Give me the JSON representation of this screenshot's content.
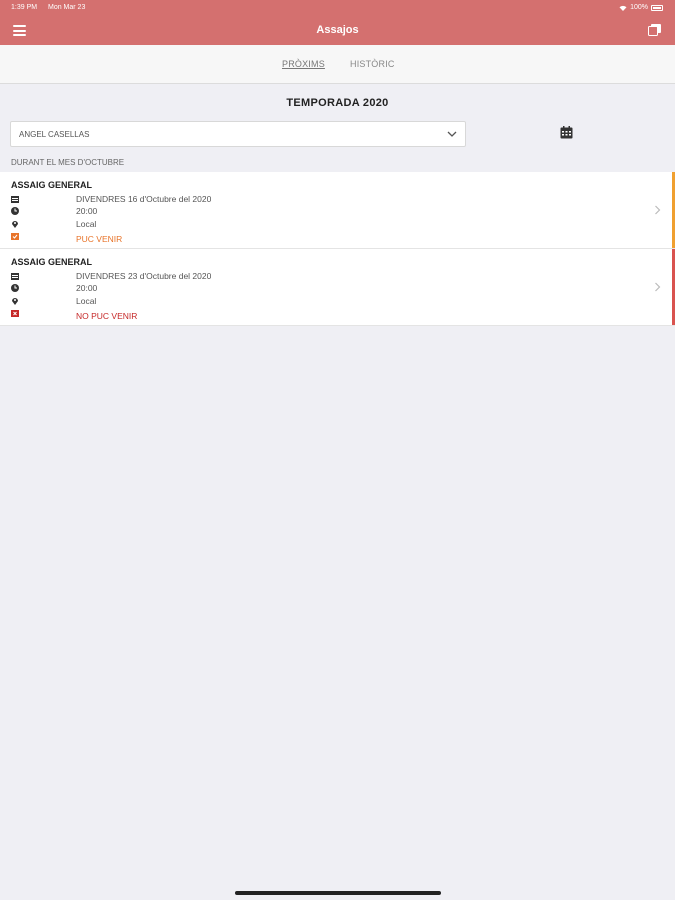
{
  "status_bar": {
    "time": "1:39 PM",
    "date": "Mon Mar 23",
    "battery": "100%"
  },
  "nav": {
    "title": "Assajos",
    "menu_icon": "hamburger-icon",
    "copy_icon": "copy-icon"
  },
  "tabs": [
    {
      "label": "PRÒXIMS",
      "active": true
    },
    {
      "label": "HISTÒRIC",
      "active": false
    }
  ],
  "season": "TEMPORADA 2020",
  "member_select": {
    "value": "ANGEL CASELLAS"
  },
  "month_label": "DURANT EL MES D'OCTUBRE",
  "events": [
    {
      "title": "ASSAIG GENERAL",
      "date": "DIVENDRES 16 d'Octubre del 2020",
      "time": "20:00",
      "place": "Local",
      "status": "PUC VENIR",
      "status_color": "#e8742a"
    },
    {
      "title": "ASSAIG GENERAL",
      "date": "DIVENDRES 23 d'Octubre del 2020",
      "time": "20:00",
      "place": "Local",
      "status": "NO PUC VENIR",
      "status_color": "#c62828"
    }
  ],
  "colors": {
    "accent": "#d4706f",
    "background": "#efeff4",
    "can_come": "#e8742a",
    "cannot_come": "#c62828"
  }
}
